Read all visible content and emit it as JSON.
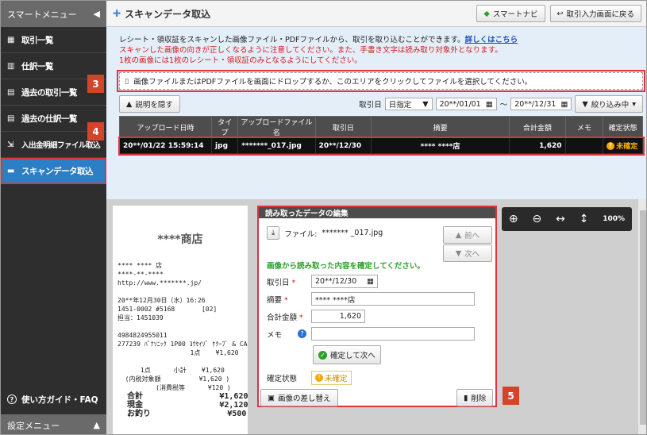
{
  "sidebar": {
    "header": "スマートメニュー",
    "items": [
      {
        "label": "取引一覧",
        "icon": "table-icon"
      },
      {
        "label": "仕訳一覧",
        "icon": "book-icon"
      },
      {
        "label": "過去の取引一覧",
        "icon": "doc-icon"
      },
      {
        "label": "過去の仕訳一覧",
        "icon": "doc-icon"
      },
      {
        "label": "入出金明細ファイル取込",
        "icon": "import-icon"
      },
      {
        "label": "スキャンデータ取込",
        "icon": "scan-icon",
        "active": true
      }
    ],
    "guide": "使い方ガイド・FAQ",
    "footer": "設定メニュー"
  },
  "header": {
    "title": "スキャンデータ取込",
    "smart_navi": "スマートナビ",
    "back": "取引入力画面に戻る"
  },
  "notice": {
    "line1": "レシート・領収証をスキャンした画像ファイル・PDFファイルから、取引を取り込むことができます。",
    "link": "詳しくはこちら",
    "line2": "スキャンした画像の向きが正しくなるように注意してください。また、手書き文字は読み取り対象外となります。",
    "line3": "1枚の画像には1枚のレシート・領収証のみとなるようにしてください。"
  },
  "dropzone": "画像ファイルまたはPDFファイルを画面にドロップするか、このエリアをクリックしてファイルを選択してください。",
  "filters": {
    "hide_desc": "説明を隠す",
    "date_label": "取引日",
    "date_mode": "日指定",
    "from": "20**/01/01",
    "tilde": "～",
    "to": "20**/12/31",
    "filter_btn": "絞り込み中"
  },
  "table": {
    "headers": [
      "アップロード日時",
      "タイプ",
      "アップロードファイル名",
      "取引日",
      "摘要",
      "合計金額",
      "メモ",
      "確定状態"
    ],
    "row": {
      "uploaded": "20**/01/22 15:59:14",
      "type": "jpg",
      "filename": "*******_017.jpg",
      "date": "20**/12/30",
      "summary": "**** ****店",
      "amount": "1,620",
      "memo": "",
      "status": "未確定"
    }
  },
  "receipt": {
    "shop": "****商店",
    "lines": [
      "**** **** 店",
      "****-**-****",
      "http://www.*******.jp/",
      "",
      "20**年12月30日（水）16:26",
      "1451-0002 #5168       [02]",
      "担当：1451039",
      "",
      "4984824955011",
      "277239 ﾊﾟﾅｿﾆｯｸ 1P00 ﾖｳｾｲｿﾞ ｹｸｰﾌﾞ & CA-LU",
      "                   1点    ¥1,620",
      "",
      "      1点      小計    ¥1,620",
      "  (内税対象額          ¥1,620 )",
      "          (消費税等      ¥120 )",
      "  合計                ¥1,620",
      "  現金                ¥2,120",
      "  お釣り                ¥500"
    ]
  },
  "editor": {
    "title": "読み取ったデータの編集",
    "file_label": "ファイル:",
    "file_name": "******* _017.jpg",
    "prev": "前へ",
    "next": "次へ",
    "confirm_msg": "画像から読み取った内容を確定してください。",
    "date_label": "取引日",
    "date_value": "20**/12/30",
    "summary_label": "摘要",
    "summary_value": "****  ****店",
    "amount_label": "合計金額",
    "amount_value": "1,620",
    "memo_label": "メモ",
    "memo_value": "",
    "confirm_next": "確定して次へ",
    "status_label": "確定状態",
    "status_value": "未確定",
    "replace": "画像の差し替え",
    "delete": "削除"
  },
  "viewer": {
    "zoom": "100%"
  },
  "callouts": [
    "2",
    "3",
    "4",
    "5"
  ],
  "colors": {
    "accent": "#2c7fc4",
    "highlight": "#d9363e",
    "callout": "#d4442a"
  }
}
